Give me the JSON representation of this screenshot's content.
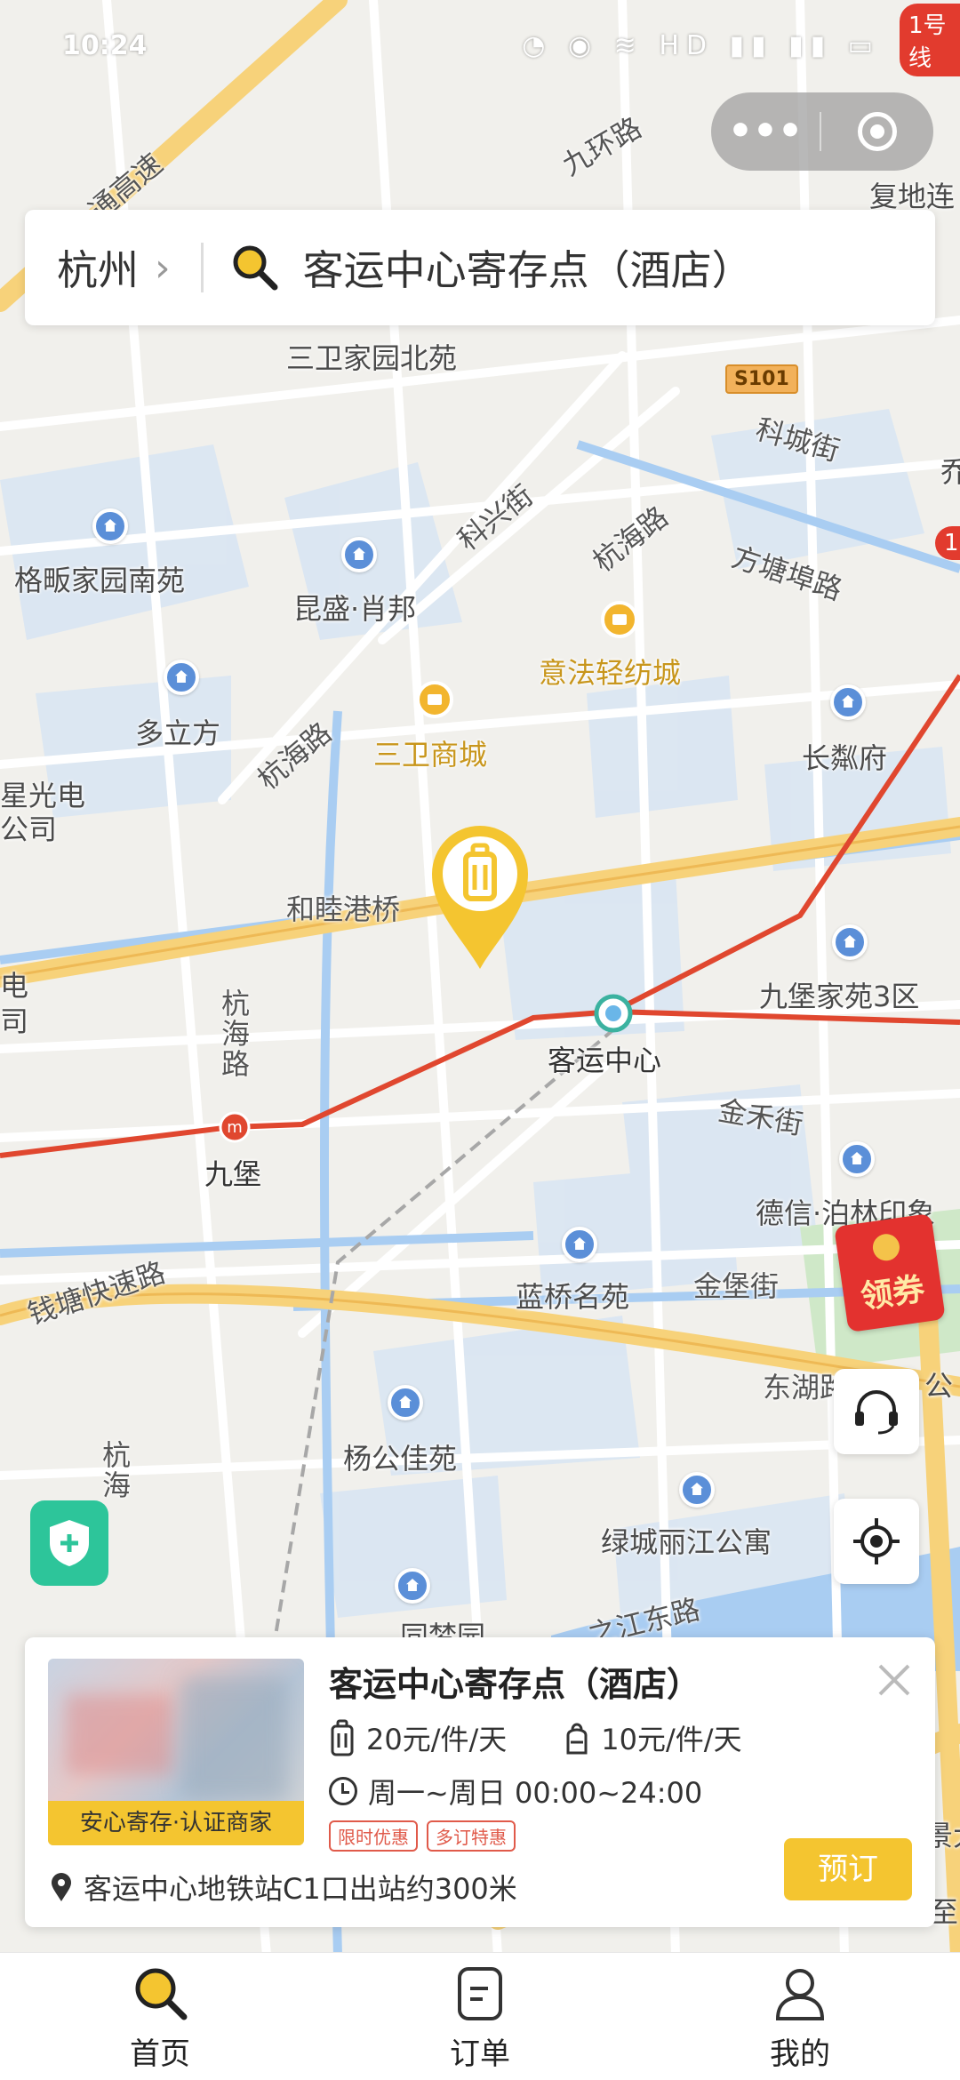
{
  "status_bar": {
    "time": "10:24",
    "icons": "◔ ◉ ≋ HD ▮▮ ▮▮ ▭"
  },
  "capsule": {
    "more_label": "•••"
  },
  "search": {
    "city": "杭州",
    "chevron": "›",
    "query": "客运中心寄存点（酒店）"
  },
  "corner_badges": [
    "1号线",
    "1"
  ],
  "map": {
    "labels": [
      {
        "text": "九环路",
        "kind": "road"
      },
      {
        "text": "复地连",
        "kind": "place"
      },
      {
        "text": "通高速",
        "kind": "road"
      },
      {
        "text": "三卫家园北苑",
        "kind": "place"
      },
      {
        "text": "科城街",
        "kind": "road"
      },
      {
        "text": "乔",
        "kind": "place"
      },
      {
        "text": "科兴街",
        "kind": "road"
      },
      {
        "text": "杭海路",
        "kind": "road"
      },
      {
        "text": "方塘埠路",
        "kind": "road"
      },
      {
        "text": "格畈家园南苑",
        "kind": "place"
      },
      {
        "text": "昆盛·肖邦",
        "kind": "place"
      },
      {
        "text": "意法轻纺城",
        "kind": "shop"
      },
      {
        "text": "多立方",
        "kind": "place"
      },
      {
        "text": "杭海路",
        "kind": "road"
      },
      {
        "text": "三卫商城",
        "kind": "shop"
      },
      {
        "text": "长粼府",
        "kind": "place"
      },
      {
        "text": "星光电",
        "kind": "place"
      },
      {
        "text": "公司",
        "kind": "place"
      },
      {
        "text": "和睦港桥",
        "kind": "road"
      },
      {
        "text": "九堡家苑3区",
        "kind": "place"
      },
      {
        "text": "电",
        "kind": "place"
      },
      {
        "text": "司",
        "kind": "place"
      },
      {
        "text": "杭海路",
        "kind": "road-vertical"
      },
      {
        "text": "客运中心",
        "kind": "metro"
      },
      {
        "text": "金禾街",
        "kind": "road"
      },
      {
        "text": "九堡",
        "kind": "metro"
      },
      {
        "text": "德信·泊林印象",
        "kind": "place"
      },
      {
        "text": "钱塘快速路",
        "kind": "road"
      },
      {
        "text": "蓝桥名苑",
        "kind": "place"
      },
      {
        "text": "金堡街",
        "kind": "road"
      },
      {
        "text": "东湖路",
        "kind": "road"
      },
      {
        "text": "公",
        "kind": "place"
      },
      {
        "text": "杨公佳苑",
        "kind": "place"
      },
      {
        "text": "杭海",
        "kind": "road-vertical"
      },
      {
        "text": "绿城丽江公寓",
        "kind": "place"
      },
      {
        "text": "之江东路",
        "kind": "road"
      },
      {
        "text": "同梦园",
        "kind": "place"
      },
      {
        "text": "景大",
        "kind": "place"
      },
      {
        "text": "至",
        "kind": "place"
      }
    ],
    "highway_shield": "S101"
  },
  "coupon": {
    "label": "领券"
  },
  "card": {
    "title": "客运中心寄存点（酒店）",
    "thumb_tag": "安心寄存·认证商家",
    "price_large": "20元/件/天",
    "price_small": "10元/件/天",
    "hours": "周一~周日 00:00~24:00",
    "badges": [
      "限时优惠",
      "多订特惠"
    ],
    "location": "客运中心地铁站C1口出站约300米",
    "book_label": "预订"
  },
  "tabs": [
    {
      "label": "首页",
      "icon": "search-icon",
      "active": true
    },
    {
      "label": "订单",
      "icon": "order-icon",
      "active": false
    },
    {
      "label": "我的",
      "icon": "user-icon",
      "active": false
    }
  ],
  "colors": {
    "accent": "#f4c530",
    "metro_line": "#e0472f",
    "water": "#cfe0f5",
    "road_major": "#f7d27a",
    "poi_blue": "#5b8fd8"
  }
}
